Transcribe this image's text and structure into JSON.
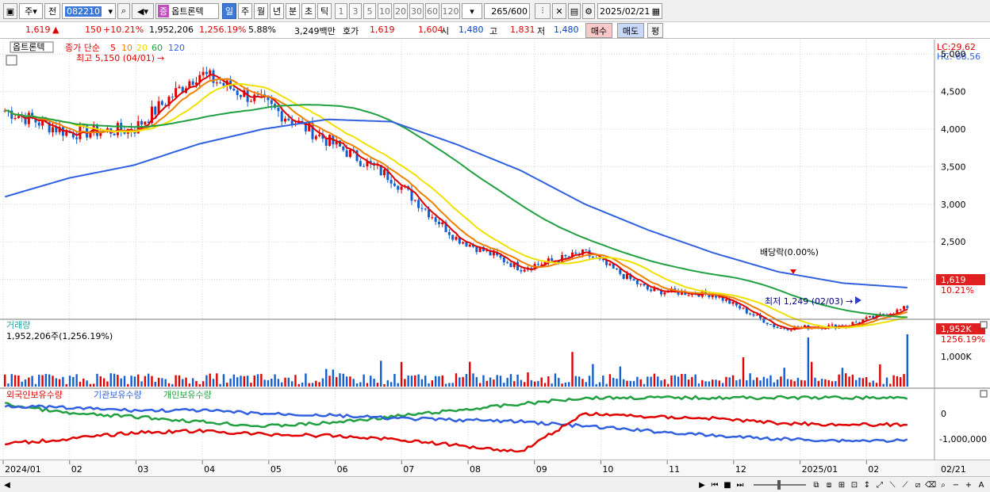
{
  "toolbar": {
    "menu1": "주",
    "menu2": "전",
    "code": "082210",
    "stock_badge": "증",
    "stock_name": "옵트론텍",
    "periods": [
      "일",
      "주",
      "월",
      "년",
      "분",
      "초",
      "틱"
    ],
    "active_period": "일",
    "nums": [
      "1",
      "3",
      "5",
      "10",
      "20",
      "30",
      "60",
      "120"
    ],
    "count_value": "265",
    "count_total": "/600",
    "date": "2025/02/21"
  },
  "quote": {
    "price": "1,619",
    "change": "150",
    "change_pct": "+10.21%",
    "volume": "1,952,206",
    "volume_pct": "1,256.19%",
    "turnover": "5.88%",
    "amount": "3,249백만",
    "hoga_label": "호가",
    "ask": "1,619",
    "bid": "1,604",
    "open_label": "시",
    "open": "1,480",
    "high_label": "고",
    "high": "1,831",
    "low_label": "저",
    "low": "1,480",
    "buy": "매수",
    "sell": "매도",
    "eval": "평"
  },
  "price_panel": {
    "name_tag": "옵트론텍",
    "legend_prefix": "종가 단순",
    "ma": [
      {
        "label": "5",
        "color": "#e00000"
      },
      {
        "label": "10",
        "color": "#f08000"
      },
      {
        "label": "20",
        "color": "#e8d800"
      },
      {
        "label": "60",
        "color": "#20a040"
      },
      {
        "label": "120",
        "color": "#3060e0"
      }
    ],
    "high_note": "최고 5,150 (04/01)",
    "low_note": "최저 1,249 (02/03)",
    "div_note": "배당락(0.00%)",
    "lc": "LC:29.62",
    "hc": "HC:-68.56",
    "current_price": "1,619",
    "current_pct": "10.21%",
    "current_color": "#e02020"
  },
  "volume_panel": {
    "title": "거래량",
    "value": "1,952,206주(1,256.19%)",
    "current": "1,952K",
    "current_pct": "1256.19%",
    "tick": "1,000K"
  },
  "holding_panel": {
    "legend": [
      {
        "label": "외국인보유수량",
        "color": "#e00000"
      },
      {
        "label": "기관보유수량",
        "color": "#3060e0"
      },
      {
        "label": "개인보유수량",
        "color": "#20a040"
      }
    ],
    "ticks": [
      "0",
      "-1,000,000"
    ]
  },
  "x_axis": {
    "labels": [
      "2024/01",
      "02",
      "03",
      "04",
      "05",
      "06",
      "07",
      "08",
      "09",
      "10",
      "11",
      "12",
      "2025/01",
      "02"
    ],
    "right_label": "02/21"
  },
  "chart_data": {
    "type": "line",
    "x": [
      "2024/01",
      "2024/02",
      "2024/03",
      "2024/04",
      "2024/05",
      "2024/06",
      "2024/07",
      "2024/08",
      "2024/09",
      "2024/10",
      "2024/11",
      "2024/12",
      "2025/01",
      "2025/02",
      "2025/02/21"
    ],
    "y_ticks": [
      "5,000",
      "4,500",
      "4,000",
      "3,500",
      "3,000",
      "2,500",
      "2,000"
    ],
    "ylim": [
      1500,
      5150
    ],
    "series": [
      {
        "name": "5",
        "values": [
          4250,
          3950,
          4000,
          4750,
          4350,
          3850,
          3350,
          2550,
          2150,
          2350,
          1850,
          1800,
          1350,
          1380,
          1619
        ]
      },
      {
        "name": "120",
        "values": [
          3100,
          3350,
          3520,
          3800,
          4000,
          4130,
          4100,
          3800,
          3450,
          3000,
          2650,
          2350,
          2100,
          1950,
          1890
        ]
      }
    ]
  }
}
